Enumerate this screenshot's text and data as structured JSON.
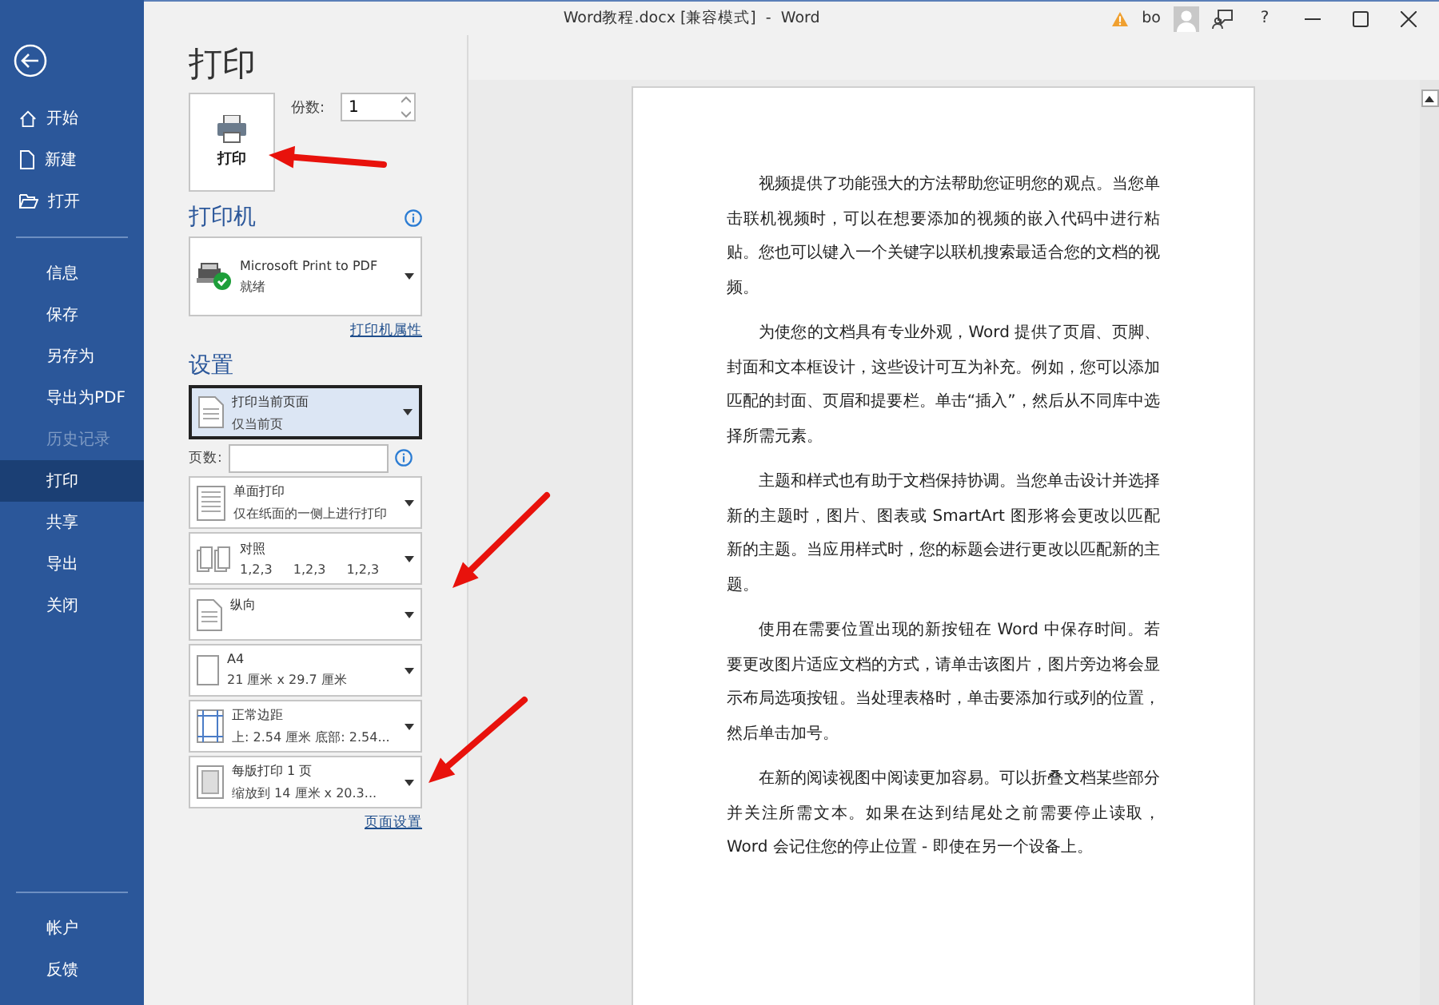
{
  "window": {
    "title": "Word教程.docx [兼容模式]  -  Word",
    "user": "bo",
    "help": "?"
  },
  "sidebar": {
    "items": [
      {
        "kind": "home",
        "label": "开始",
        "selected": false,
        "disabled": false
      },
      {
        "kind": "new",
        "label": "新建",
        "selected": false,
        "disabled": false
      },
      {
        "kind": "open",
        "label": "打开",
        "selected": false,
        "disabled": false
      },
      {
        "kind": "divider"
      },
      {
        "kind": "text",
        "label": "信息",
        "selected": false,
        "disabled": false
      },
      {
        "kind": "text",
        "label": "保存",
        "selected": false,
        "disabled": false
      },
      {
        "kind": "text",
        "label": "另存为",
        "selected": false,
        "disabled": false
      },
      {
        "kind": "text",
        "label": "导出为PDF",
        "selected": false,
        "disabled": false
      },
      {
        "kind": "text",
        "label": "历史记录",
        "selected": false,
        "disabled": true
      },
      {
        "kind": "text",
        "label": "打印",
        "selected": true,
        "disabled": false
      },
      {
        "kind": "text",
        "label": "共享",
        "selected": false,
        "disabled": false
      },
      {
        "kind": "text",
        "label": "导出",
        "selected": false,
        "disabled": false
      },
      {
        "kind": "text",
        "label": "关闭",
        "selected": false,
        "disabled": false
      }
    ],
    "footer_items": [
      {
        "label": "帐户"
      },
      {
        "label": "反馈"
      }
    ]
  },
  "page_title": "打印",
  "print_button": "打印",
  "copies": {
    "label": "份数:",
    "value": "1"
  },
  "printer": {
    "heading": "打印机",
    "name": "Microsoft Print to PDF",
    "status": "就绪",
    "properties_link": "打印机属性"
  },
  "settings": {
    "heading": "设置",
    "options": [
      {
        "kind": "pages",
        "line1": "打印当前页面",
        "line2": "仅当前页",
        "selected": true
      },
      {
        "kind": "field",
        "label": "页数:"
      },
      {
        "kind": "sides",
        "line1": "单面打印",
        "line2": "仅在纸面的一侧上进行打印",
        "selected": false
      },
      {
        "kind": "collate",
        "line1": "对照",
        "values": [
          "1,2,3",
          "1,2,3",
          "1,2,3"
        ],
        "selected": false
      },
      {
        "kind": "orientation",
        "line1": "纵向",
        "selected": false
      },
      {
        "kind": "paper",
        "line1": "A4",
        "line2": "21 厘米 x 29.7 厘米",
        "selected": false
      },
      {
        "kind": "margins",
        "line1": "正常边距",
        "line2": "上: 2.54 厘米 底部: 2.54...",
        "selected": false
      },
      {
        "kind": "scale",
        "line1": "每版打印 1 页",
        "line2": "缩放到 14 厘米 x 20.3...",
        "selected": false
      }
    ],
    "page_setup_link": "页面设置"
  },
  "document": {
    "paragraphs": [
      "视频提供了功能强大的方法帮助您证明您的观点。当您单击联机视频时，可以在想要添加的视频的嵌入代码中进行粘贴。您也可以键入一个关键字以联机搜索最适合您的文档的视频。",
      "为使您的文档具有专业外观，Word 提供了页眉、页脚、封面和文本框设计，这些设计可互为补充。例如，您可以添加匹配的封面、页眉和提要栏。单击“插入”，然后从不同库中选择所需元素。",
      "主题和样式也有助于文档保持协调。当您单击设计并选择新的主题时，图片、图表或 SmartArt 图形将会更改以匹配新的主题。当应用样式时，您的标题会进行更改以匹配新的主题。",
      "使用在需要位置出现的新按钮在 Word 中保存时间。若要更改图片适应文档的方式，请单击该图片，图片旁边将会显示布局选项按钮。当处理表格时，单击要添加行或列的位置，然后单击加号。",
      "在新的阅读视图中阅读更加容易。可以折叠文档某些部分并关注所需文本。如果在达到结尾处之前需要停止读取，Word 会记住您的停止位置 - 即使在另一个设备上。"
    ]
  }
}
